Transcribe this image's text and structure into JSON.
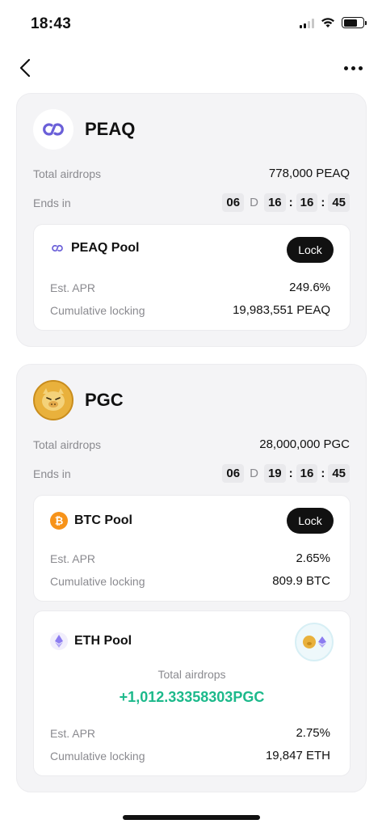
{
  "status_bar": {
    "time": "18:43"
  },
  "nav": {
    "back_icon": "chevron-left-icon",
    "more_icon": "more-horizontal-icon"
  },
  "colors": {
    "accent_green": "#1cb98b",
    "peaq_purple": "#6a5fd8",
    "btc_orange": "#f7931a",
    "eth_purple": "#8c7cf0",
    "button_black": "#111111"
  },
  "peaq": {
    "name": "PEAQ",
    "total_airdrops_label": "Total airdrops",
    "total_airdrops_value": "778,000 PEAQ",
    "ends_in_label": "Ends in",
    "countdown": {
      "days": "06",
      "day_unit": "D",
      "hours": "16",
      "minutes": "16",
      "seconds": "45"
    },
    "pool": {
      "name": "PEAQ Pool",
      "button_label": "Lock",
      "apr_label": "Est. APR",
      "apr_value": "249.6%",
      "locking_label": "Cumulative locking",
      "locking_value": "19,983,551 PEAQ"
    }
  },
  "pgc": {
    "name": "PGC",
    "total_airdrops_label": "Total airdrops",
    "total_airdrops_value": "28,000,000 PGC",
    "ends_in_label": "Ends in",
    "countdown": {
      "days": "06",
      "day_unit": "D",
      "hours": "19",
      "minutes": "16",
      "seconds": "45"
    },
    "btc_pool": {
      "name": "BTC Pool",
      "button_label": "Lock",
      "apr_label": "Est. APR",
      "apr_value": "2.65%",
      "locking_label": "Cumulative locking",
      "locking_value": "809.9 BTC"
    },
    "eth_pool": {
      "name": "ETH Pool",
      "airdrops_label": "Total airdrops",
      "airdrops_value": "+1,012.33358303PGC",
      "apr_label": "Est. APR",
      "apr_value": "2.75%",
      "locking_label": "Cumulative locking",
      "locking_value": "19,847 ETH"
    }
  }
}
